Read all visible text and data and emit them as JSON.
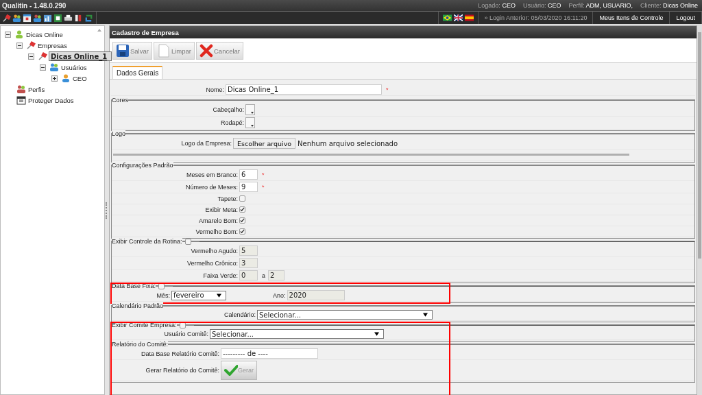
{
  "app_title": "Qualitin - 1.48.0.290",
  "user_info": [
    {
      "label": "Logado:",
      "value": "CEO"
    },
    {
      "label": "Usuário:",
      "value": "CEO"
    },
    {
      "label": "Perfil:",
      "value": "ADM, USUARIO,"
    },
    {
      "label": "Cliente:",
      "value": "Dicas Online"
    }
  ],
  "login_previous": "» Login Anterior: 05/03/2020 16:11:20",
  "top_links": [
    "Meus Itens de Controle",
    "Logout"
  ],
  "tree": [
    {
      "label": "Dicas Online",
      "kind": "client",
      "expanded": true,
      "selected": false,
      "children": [
        {
          "label": "Empresas",
          "kind": "companies",
          "expanded": true,
          "selected": false,
          "children": [
            {
              "label": "Dicas Online_1",
              "kind": "company",
              "expanded": true,
              "selected": true,
              "children": [
                {
                  "label": "Usuários",
                  "kind": "users",
                  "expanded": true,
                  "selected": false,
                  "children": [
                    {
                      "label": "CEO",
                      "kind": "user",
                      "expanded": false,
                      "selected": false
                    }
                  ]
                }
              ]
            }
          ]
        },
        {
          "label": "Perfis",
          "kind": "profiles",
          "selected": false
        },
        {
          "label": "Proteger Dados",
          "kind": "protect",
          "selected": false
        }
      ]
    }
  ],
  "panel_title": "Cadastro de Empresa",
  "actions": [
    {
      "label": "Salvar",
      "kind": "save"
    },
    {
      "label": "Limpar",
      "kind": "clear"
    },
    {
      "label": "Cancelar",
      "kind": "cancel"
    }
  ],
  "tabs": [
    {
      "label": "Dados Gerais",
      "selected": true
    }
  ],
  "sections": [
    {
      "highlighted": false,
      "rows": [
        {
          "label": "Nome:",
          "controls": [
            {
              "kind": "input",
              "value": "Dicas Online_1",
              "disabled": false
            },
            {
              "kind": "mark",
              "text": "*"
            }
          ]
        }
      ]
    },
    {
      "legend": "Cores",
      "highlighted": false,
      "rows": [
        {
          "label": "Cabeçalho:",
          "controls": [
            {
              "kind": "color"
            }
          ]
        },
        {
          "label": "Rodapé:",
          "controls": [
            {
              "kind": "color"
            }
          ]
        }
      ]
    },
    {
      "legend": "Logo",
      "highlighted": false,
      "rows": [
        {
          "label": "Logo da Empresa:",
          "controls": [
            {
              "kind": "file",
              "button": "Escolher arquivo",
              "status": "Nenhum arquivo selecionado"
            }
          ]
        },
        {
          "controls": [
            {
              "kind": "rule"
            }
          ]
        }
      ]
    },
    {
      "legend": "Configurações Padrão",
      "highlighted": false,
      "rows": [
        {
          "label": "Meses em Branco:",
          "controls": [
            {
              "kind": "input",
              "value": "6",
              "disabled": false
            },
            {
              "kind": "mark",
              "text": "*"
            }
          ]
        },
        {
          "label": "Número de Meses:",
          "controls": [
            {
              "kind": "input",
              "value": "9",
              "disabled": false
            },
            {
              "kind": "mark",
              "text": "*"
            }
          ]
        },
        {
          "label": "Tapete:",
          "controls": [
            {
              "kind": "checkbox",
              "checked": false
            }
          ]
        },
        {
          "label": "Exibir Meta:",
          "controls": [
            {
              "kind": "checkbox",
              "checked": true
            }
          ]
        },
        {
          "label": "Amarelo Bom:",
          "controls": [
            {
              "kind": "checkbox",
              "checked": true
            }
          ]
        },
        {
          "label": "Vermelho Bom:",
          "controls": [
            {
              "kind": "checkbox",
              "checked": true
            }
          ]
        }
      ]
    },
    {
      "legend": "Exibir Controle da Rotina:",
      "legend_checked": false,
      "highlighted": false,
      "rows": [
        {
          "label": "Vermelho Agudo:",
          "controls": [
            {
              "kind": "input",
              "value": "5",
              "disabled": true
            }
          ]
        },
        {
          "label": "Vermelho Crônico:",
          "controls": [
            {
              "kind": "input",
              "value": "3",
              "disabled": true
            }
          ]
        },
        {
          "label": "Faixa Verde:",
          "controls": [
            {
              "kind": "input",
              "value": "0",
              "disabled": true
            },
            {
              "kind": "text",
              "text": "a"
            },
            {
              "kind": "input",
              "value": "2",
              "disabled": true
            }
          ]
        }
      ]
    },
    {
      "legend": "Data Base Fixa:",
      "legend_checked": false,
      "highlighted": true,
      "rows": [
        {
          "label": "Mês:",
          "controls": [
            {
              "kind": "select",
              "value": "fevereiro"
            },
            {
              "kind": "label",
              "text": "Ano:"
            },
            {
              "kind": "input",
              "value": "2020",
              "disabled": true
            }
          ]
        }
      ]
    },
    {
      "legend": "Calendário Padrão",
      "highlighted": false,
      "rows": [
        {
          "label": "Calendário:",
          "controls": [
            {
              "kind": "select",
              "value": "Selecionar..."
            }
          ]
        }
      ]
    },
    {
      "legend": "Exibir Comite Empresa:",
      "legend_checked": false,
      "highlighted": true,
      "rows": [
        {
          "label": "Usuário Comitê:",
          "controls": [
            {
              "kind": "select",
              "value": "Selecionar..."
            }
          ]
        }
      ]
    },
    {
      "legend": "Relatório do Comitê:",
      "highlighted": true,
      "rows": [
        {
          "label": "Data Base Relatório Comitê:",
          "controls": [
            {
              "kind": "input",
              "value": "--------- de ----",
              "disabled": false
            }
          ]
        },
        {
          "label": "Gerar Relatório do Comitê:",
          "controls": [
            {
              "kind": "button",
              "label": "Gerar"
            }
          ]
        }
      ]
    }
  ]
}
